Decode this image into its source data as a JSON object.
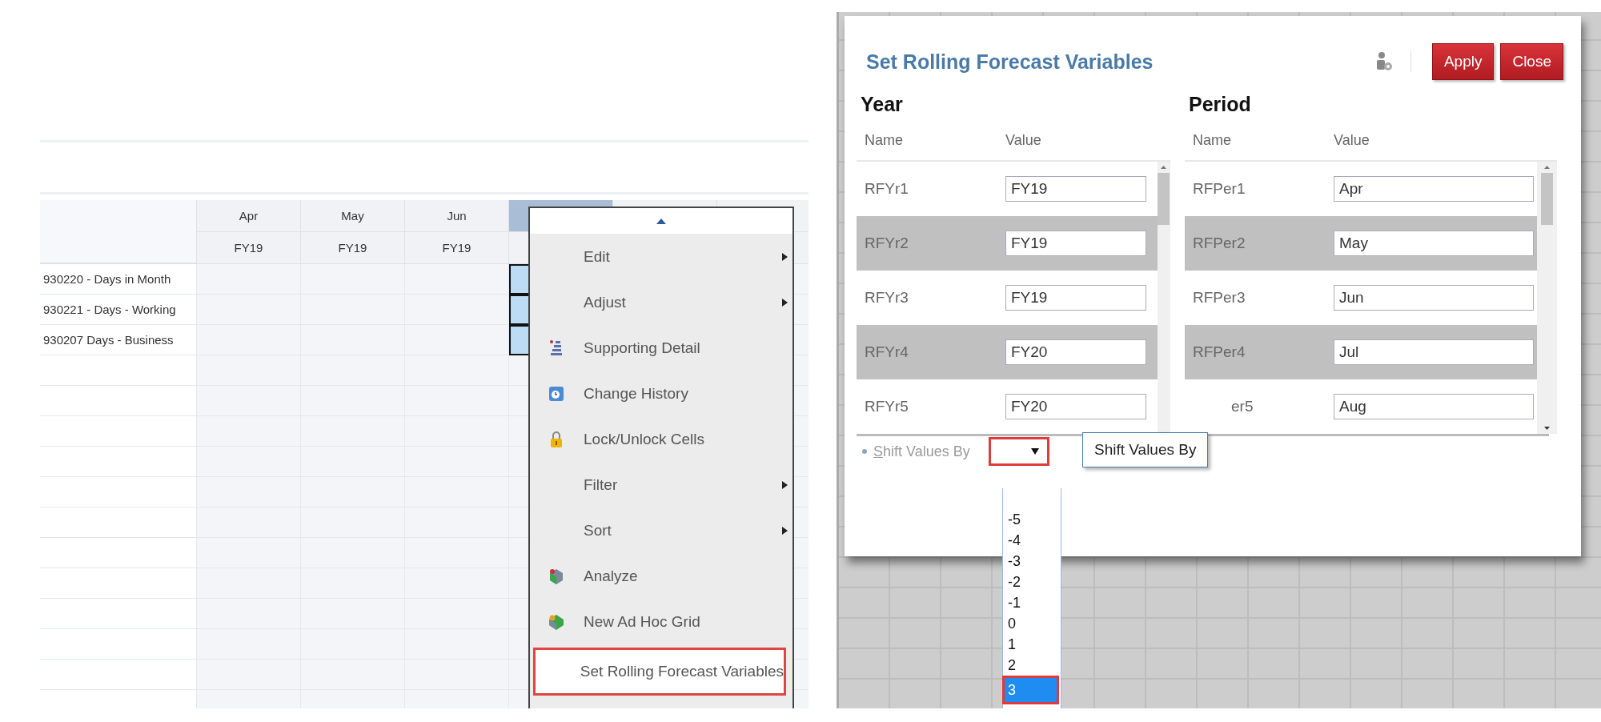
{
  "grid": {
    "columns": [
      {
        "month": "Apr",
        "year": "FY19"
      },
      {
        "month": "May",
        "year": "FY19"
      },
      {
        "month": "Jun",
        "year": "FY19"
      }
    ],
    "rows": [
      {
        "label": "930220 - Days in Month",
        "selected": true
      },
      {
        "label": "930221 - Days - Working",
        "selected": true
      },
      {
        "label": "930207 Days - Business",
        "selected": true
      }
    ]
  },
  "context_menu": {
    "items": [
      {
        "label": "Edit",
        "submenu": true,
        "highlighted": false
      },
      {
        "label": "Adjust",
        "submenu": true,
        "highlighted": false
      },
      {
        "label": "Supporting Detail",
        "submenu": false,
        "highlighted": false
      },
      {
        "label": "Change History",
        "submenu": false,
        "highlighted": false
      },
      {
        "label": "Lock/Unlock Cells",
        "submenu": false,
        "highlighted": false
      },
      {
        "label": "Filter",
        "submenu": true,
        "highlighted": false
      },
      {
        "label": "Sort",
        "submenu": true,
        "highlighted": false
      },
      {
        "label": "Analyze",
        "submenu": false,
        "highlighted": false
      },
      {
        "label": "New Ad Hoc Grid",
        "submenu": false,
        "highlighted": false
      },
      {
        "label": "Set Rolling Forecast Variables",
        "submenu": false,
        "highlighted": true
      }
    ]
  },
  "dialog": {
    "title": "Set Rolling Forecast Variables",
    "buttons": [
      "Apply",
      "Close"
    ],
    "year": {
      "heading": "Year",
      "columns": [
        "Name",
        "Value"
      ],
      "rows": [
        {
          "name": "RFYr1",
          "value": "FY19"
        },
        {
          "name": "RFYr2",
          "value": "FY19"
        },
        {
          "name": "RFYr3",
          "value": "FY19"
        },
        {
          "name": "RFYr4",
          "value": "FY20"
        },
        {
          "name": "RFYr5",
          "value": "FY20"
        }
      ]
    },
    "period": {
      "heading": "Period",
      "columns": [
        "Name",
        "Value"
      ],
      "rows": [
        {
          "name": "RFPer1",
          "value": "Apr"
        },
        {
          "name": "RFPer2",
          "value": "May"
        },
        {
          "name": "RFPer3",
          "value": "Jun"
        },
        {
          "name": "RFPer4",
          "value": "Jul"
        },
        {
          "name": "er5",
          "value": "Aug"
        }
      ]
    },
    "shift": {
      "label": "Shift Values By",
      "required": true,
      "highlighted": true,
      "tooltip": "Shift Values By",
      "options": [
        {
          "label": "-5",
          "selected": false
        },
        {
          "label": "-4",
          "selected": false
        },
        {
          "label": "-3",
          "selected": false
        },
        {
          "label": "-2",
          "selected": false
        },
        {
          "label": "-1",
          "selected": false
        },
        {
          "label": "0",
          "selected": false
        },
        {
          "label": "1",
          "selected": false
        },
        {
          "label": "2",
          "selected": false
        },
        {
          "label": "3",
          "selected": true
        }
      ]
    }
  }
}
